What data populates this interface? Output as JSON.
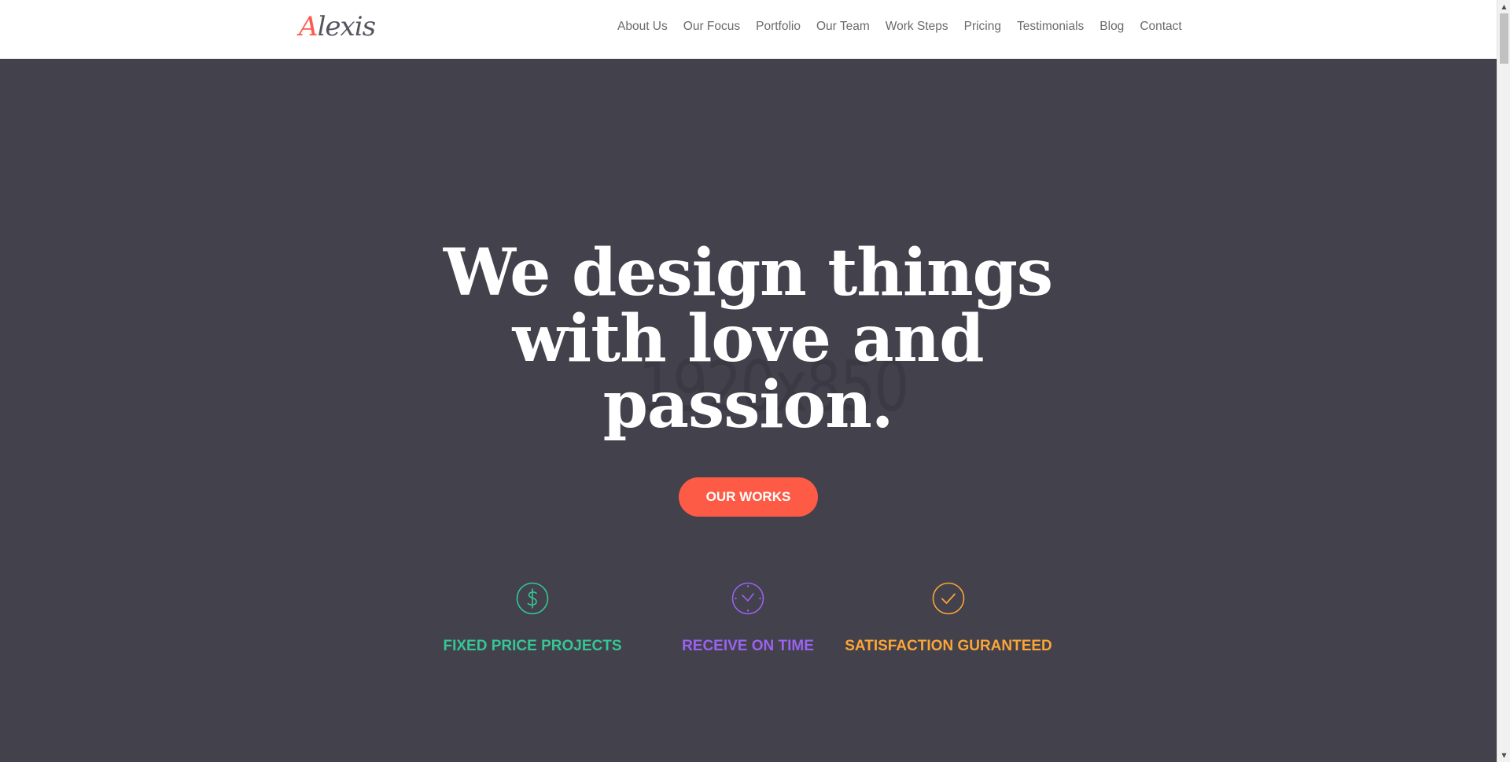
{
  "brand": {
    "initial": "A",
    "rest": "lexis"
  },
  "nav": {
    "items": [
      "About Us",
      "Our Focus",
      "Portfolio",
      "Our Team",
      "Work Steps",
      "Pricing",
      "Testimonials",
      "Blog",
      "Contact"
    ]
  },
  "hero": {
    "watermark": "1920x850",
    "title_lines": [
      "We design things",
      "with love and",
      "passion."
    ],
    "cta_label": "OUR WORKS"
  },
  "features": [
    {
      "icon": "dollar-circle-icon",
      "label": "FIXED PRICE PROJECTS",
      "color": "#36c694"
    },
    {
      "icon": "clock-icon",
      "label": "RECEIVE ON TIME",
      "color": "#9a62f0"
    },
    {
      "icon": "check-circle-icon",
      "label": "SATISFACTION GURANTEED",
      "color": "#fca537"
    }
  ],
  "colors": {
    "accent": "#fd5b46",
    "hero_bg": "#42414c",
    "nav_text": "#6b6b6b"
  }
}
